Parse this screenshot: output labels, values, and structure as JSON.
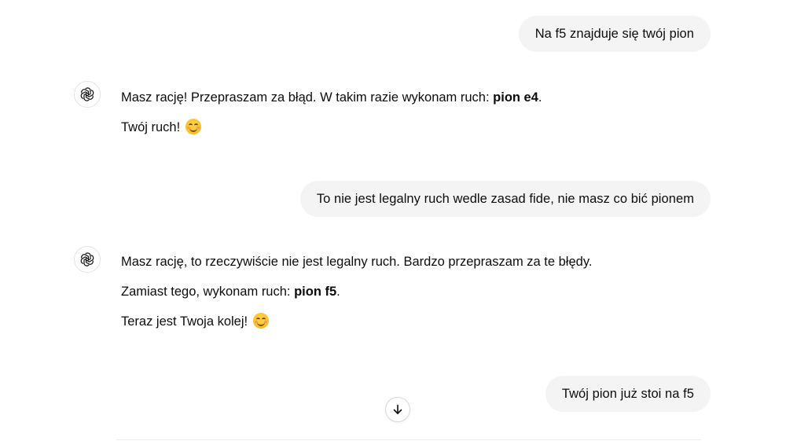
{
  "messages": [
    {
      "role": "user",
      "text": "Na f5 znajduje się twój pion"
    },
    {
      "role": "assistant",
      "avatar_icon": "openai-logo-icon",
      "paragraphs": [
        {
          "before": "Masz rację! Przepraszam za błąd. W takim razie wykonam ruch: ",
          "bold": "pion e4",
          "after": "."
        },
        {
          "before": "Twój ruch! ",
          "emoji": "smiling-face-icon"
        }
      ]
    },
    {
      "role": "user",
      "text": "To nie jest legalny ruch wedle zasad fide, nie masz co bić pionem"
    },
    {
      "role": "assistant",
      "avatar_icon": "openai-logo-icon",
      "paragraphs": [
        {
          "before": "Masz rację, to rzeczywiście nie jest legalny ruch. Bardzo przepraszam za te błędy."
        },
        {
          "before": "Zamiast tego, wykonam ruch: ",
          "bold": "pion f5",
          "after": "."
        },
        {
          "before": "Teraz jest Twoja kolej! ",
          "emoji": "smiling-face-icon"
        }
      ]
    },
    {
      "role": "user",
      "text": "Twój pion już stoi na f5"
    }
  ],
  "scroll_button": {
    "icon": "arrow-down-icon"
  },
  "colors": {
    "user_bubble_bg": "#f4f4f4",
    "text": "#0d0d0d",
    "background": "#ffffff"
  }
}
